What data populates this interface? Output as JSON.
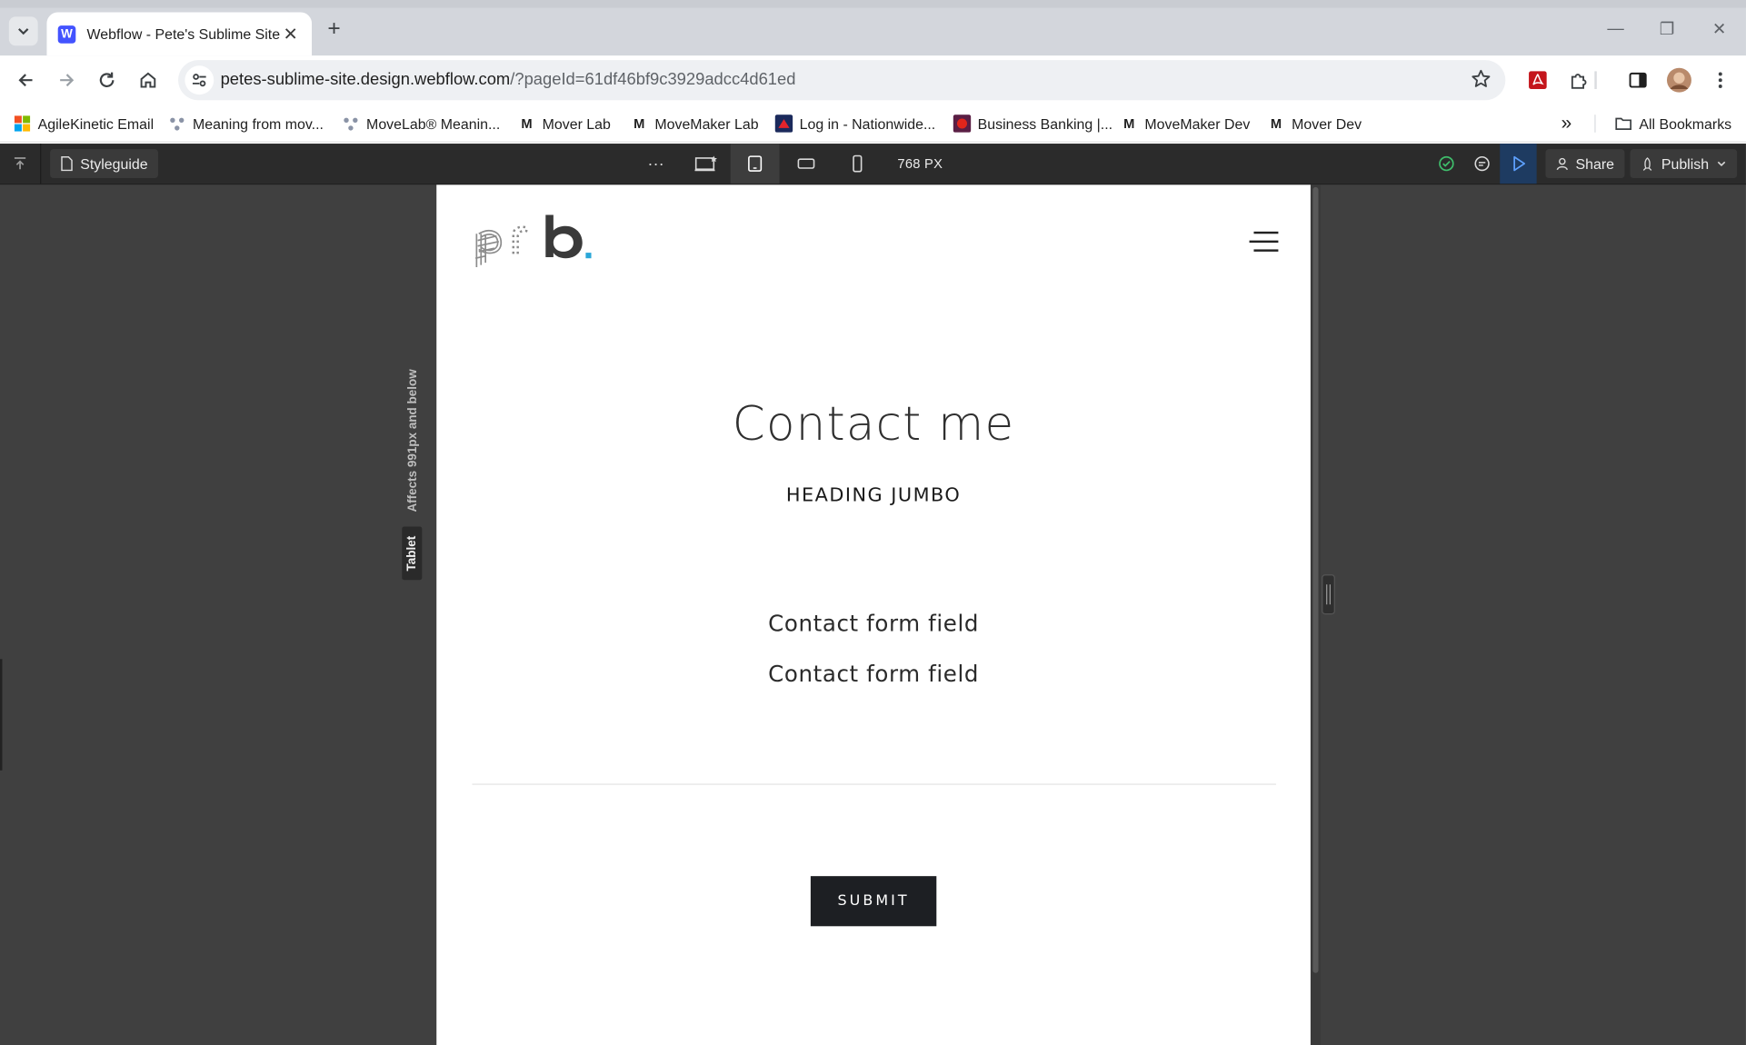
{
  "browser": {
    "tab": {
      "favicon_letter": "W",
      "title": "Webflow - Pete's Sublime Site",
      "close": "✕"
    },
    "new_tab": "+",
    "window_controls": {
      "minimize": "—",
      "restore": "❐",
      "close": "✕"
    },
    "address": {
      "host": "petes-sublime-site.design.webflow.com",
      "path": "/?pageId=61df46bf9c3929adcc4d61ed"
    },
    "bookmarks": [
      {
        "label": "AgileKinetic Email"
      },
      {
        "label": "Meaning from mov..."
      },
      {
        "label": "MoveLab® Meanin..."
      },
      {
        "label": "Mover Lab",
        "icon_letter": "M"
      },
      {
        "label": "MoveMaker Lab",
        "icon_letter": "M"
      },
      {
        "label": "Log in - Nationwide..."
      },
      {
        "label": "Business Banking |..."
      },
      {
        "label": "MoveMaker Dev",
        "icon_letter": "M"
      },
      {
        "label": "Mover Dev",
        "icon_letter": "M"
      }
    ],
    "overflow": "»",
    "all_bookmarks": "All Bookmarks"
  },
  "webflow": {
    "page_name": "Styleguide",
    "more": "···",
    "canvas_width": "768 PX",
    "share_label": "Share",
    "publish_label": "Publish",
    "breakpoint_affects": "Affects 991px and below",
    "breakpoint_name": "Tablet"
  },
  "site": {
    "logo_text": "prb.",
    "heading": "Contact me",
    "subheading": "HEADING JUMBO",
    "fields": [
      "Contact form field",
      "Contact form field"
    ],
    "submit_label": "SUBMIT"
  },
  "colors": {
    "webflow_bar": "#2b2b2b",
    "canvas_bg": "#404040",
    "preview_active": "#1e3b61",
    "logo_dot": "#2aa7d8",
    "submit_bg": "#1d1f23"
  }
}
